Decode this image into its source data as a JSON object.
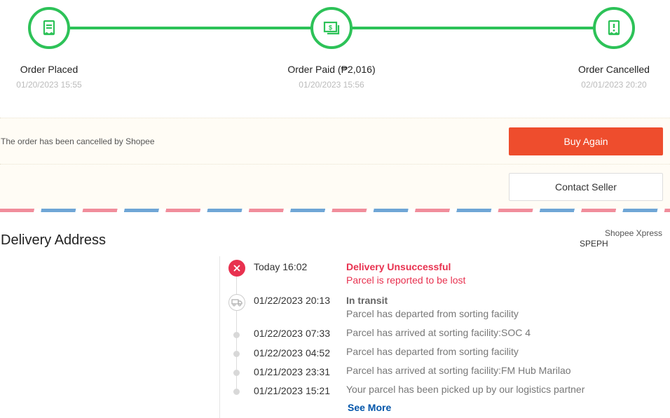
{
  "stepper": {
    "steps": [
      {
        "label": "Order Placed",
        "time": "01/20/2023 15:55",
        "icon": "receipt-icon"
      },
      {
        "label": "Order Paid (₱2,016)",
        "time": "01/20/2023 15:56",
        "icon": "money-icon"
      },
      {
        "label": "Order Cancelled",
        "time": "02/01/2023 20:20",
        "icon": "cancel-receipt-icon"
      }
    ],
    "color": "#2dc258"
  },
  "notice": {
    "message": "The order has been cancelled by Shopee",
    "buy_again_label": "Buy Again",
    "contact_seller_label": "Contact Seller"
  },
  "delivery": {
    "title": "Delivery Address",
    "carrier": "Shopee Xpress",
    "carrier_code": "SPEPH",
    "events": [
      {
        "time": "Today 16:02",
        "status": "Delivery Unsuccessful",
        "desc": "Parcel is reported to be lost",
        "icon": "close-icon"
      },
      {
        "time": "01/22/2023 20:13",
        "status": "In transit",
        "desc": "Parcel has departed from sorting facility",
        "icon": "truck-icon"
      },
      {
        "time": "01/22/2023 07:33",
        "desc": "Parcel has arrived at sorting facility:SOC 4"
      },
      {
        "time": "01/22/2023 04:52",
        "desc": "Parcel has departed from sorting facility"
      },
      {
        "time": "01/21/2023 23:31",
        "desc": "Parcel has arrived at sorting facility:FM Hub Marilao"
      },
      {
        "time": "01/21/2023 15:21",
        "desc": "Your parcel has been picked up by our logistics partner"
      }
    ],
    "see_more_label": "See More",
    "accent_red": "#e8314f",
    "link_color": "#05a"
  }
}
